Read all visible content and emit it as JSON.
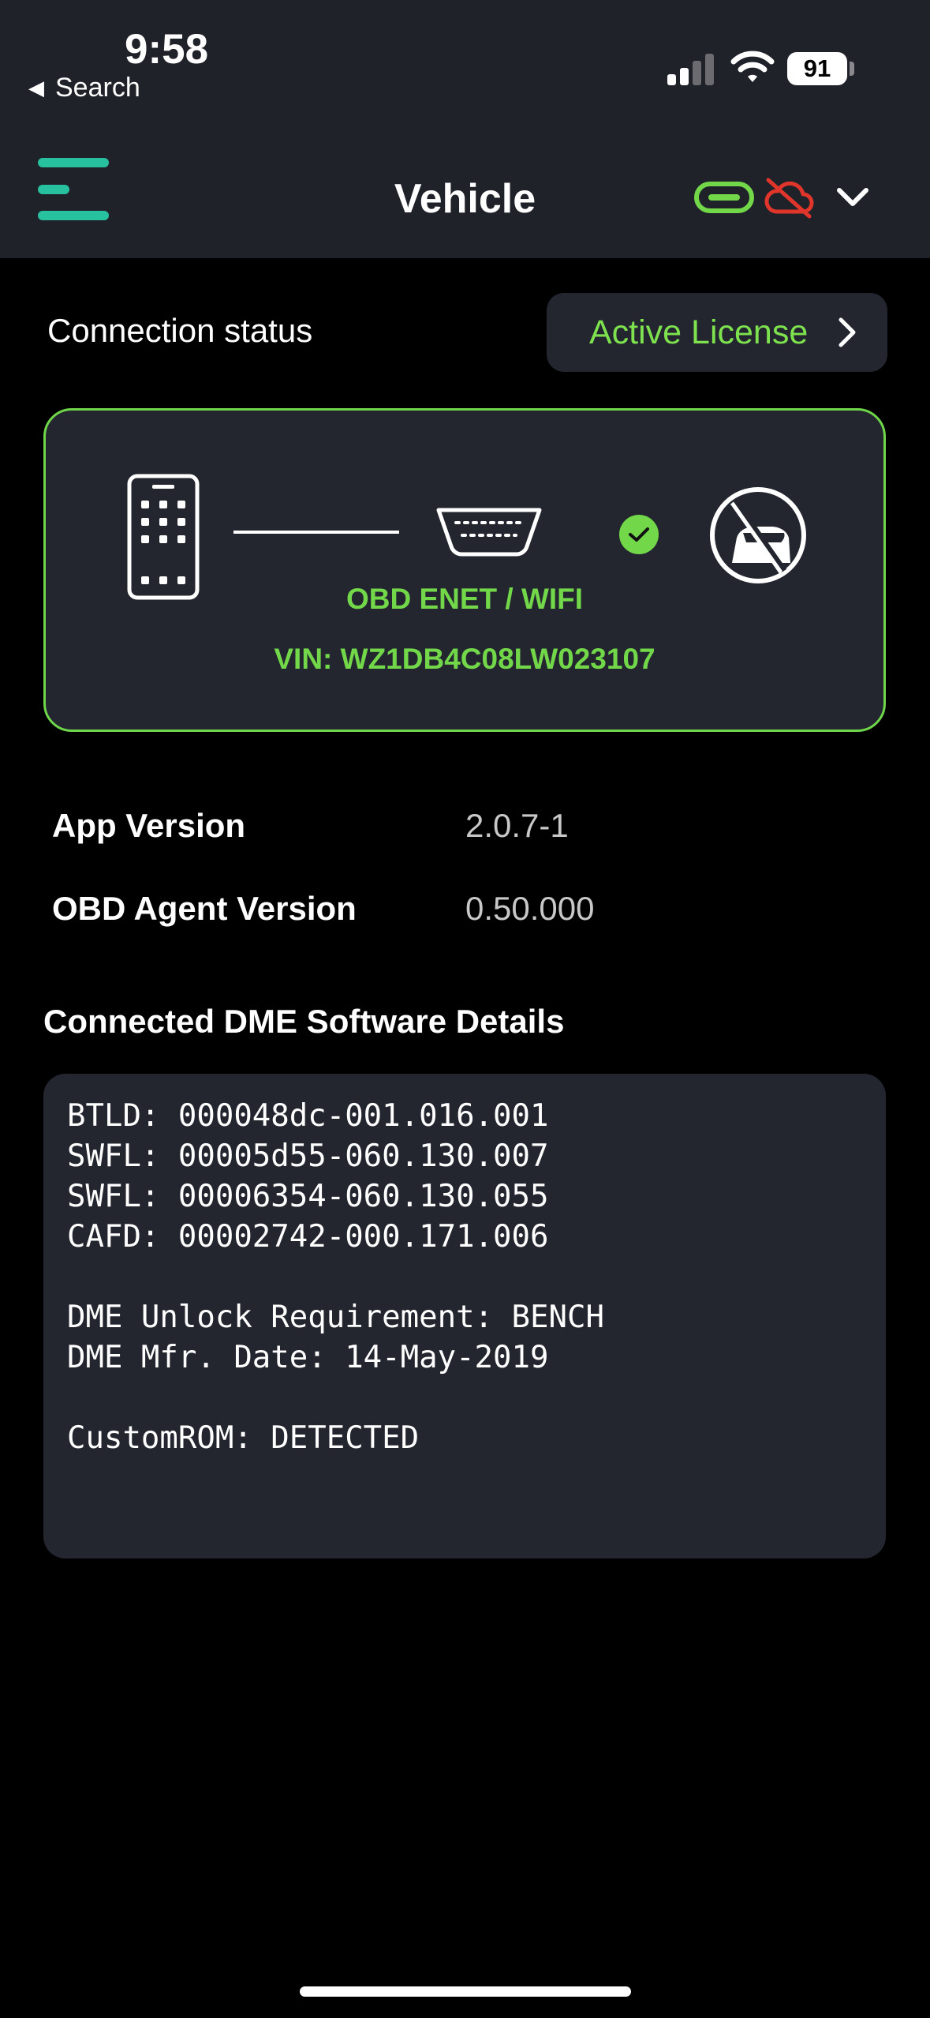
{
  "status_bar": {
    "time": "9:58",
    "back_label": "Search",
    "battery": "91"
  },
  "nav": {
    "title": "Vehicle",
    "menu_icon": "hamburger-menu-icon",
    "link_icon": "link-icon",
    "cloud_icon": "cloud-offline-icon",
    "chevron_icon": "chevron-down-icon"
  },
  "connection": {
    "label": "Connection status",
    "license_button": "Active License",
    "adapter": "OBD ENET / WIFI",
    "vin": "VIN: WZ1DB4C08LW023107"
  },
  "versions": [
    {
      "key": "App Version",
      "value": "2.0.7-1"
    },
    {
      "key": "OBD Agent Version",
      "value": "0.50.000"
    }
  ],
  "dme": {
    "title": "Connected DME Software Details",
    "lines": [
      "BTLD: 000048dc-001.016.001",
      "SWFL: 00005d55-060.130.007",
      "SWFL: 00006354-060.130.055",
      "CAFD: 00002742-000.171.006",
      "",
      "DME Unlock Requirement: BENCH",
      "DME Mfr. Date: 14-May-2019",
      "",
      "CustomROM: DETECTED"
    ]
  },
  "colors": {
    "accent_green": "#72d84a",
    "menu_teal": "#28c1a0",
    "cloud_red": "#e0352b",
    "card_bg": "#23262f"
  }
}
